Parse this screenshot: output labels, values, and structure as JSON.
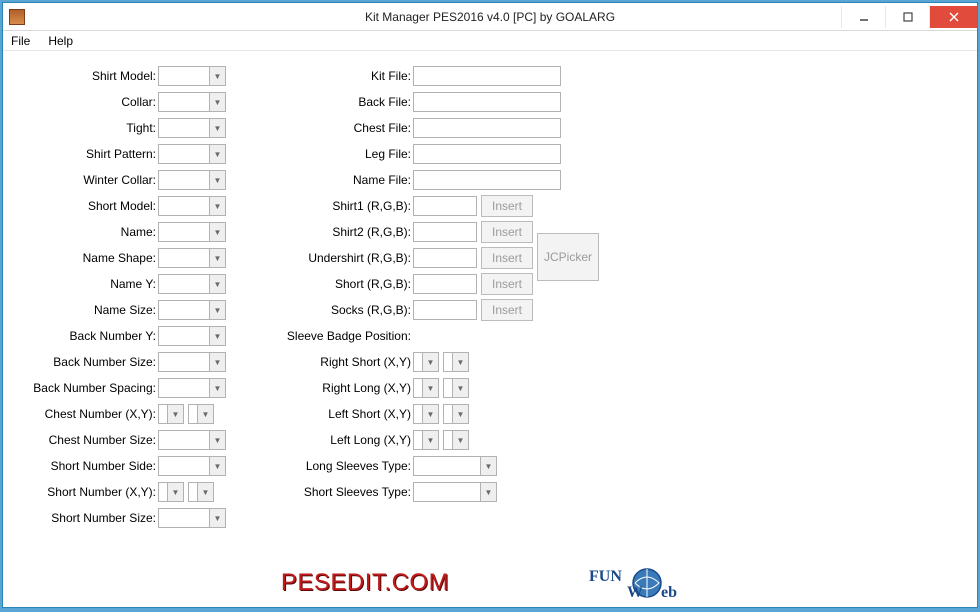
{
  "window": {
    "title": "Kit Manager PES2016 v4.0 [PC] by GOALARG"
  },
  "menu": {
    "file": "File",
    "help": "Help"
  },
  "left_labels": {
    "shirt_model": "Shirt Model:",
    "collar": "Collar:",
    "tight": "Tight:",
    "shirt_pattern": "Shirt Pattern:",
    "winter_collar": "Winter Collar:",
    "short_model": "Short Model:",
    "name": "Name:",
    "name_shape": "Name Shape:",
    "name_y": "Name Y:",
    "name_size": "Name Size:",
    "back_number_y": "Back Number Y:",
    "back_number_size": "Back Number Size:",
    "back_number_spacing": "Back Number Spacing:",
    "chest_number_xy": "Chest Number (X,Y):",
    "chest_number_size": "Chest Number Size:",
    "short_number_side": "Short Number Side:",
    "short_number_xy": "Short Number (X,Y):",
    "short_number_size": "Short Number Size:"
  },
  "right_labels": {
    "kit_file": "Kit File:",
    "back_file": "Back File:",
    "chest_file": "Chest File:",
    "leg_file": "Leg File:",
    "name_file": "Name File:",
    "shirt1_rgb": "Shirt1 (R,G,B):",
    "shirt2_rgb": "Shirt2 (R,G,B):",
    "undershirt_rgb": "Undershirt (R,G,B):",
    "short_rgb": "Short (R,G,B):",
    "socks_rgb": "Socks (R,G,B):",
    "sleeve_badge": "Sleeve Badge Position:",
    "right_short_xy": "Right Short (X,Y)",
    "right_long_xy": "Right Long (X,Y)",
    "left_short_xy": "Left Short (X,Y)",
    "left_long_xy": "Left Long (X,Y)",
    "long_sleeves_type": "Long Sleeves Type:",
    "short_sleeves_type": "Short Sleeves Type:"
  },
  "buttons": {
    "insert": "Insert",
    "jcpicker": "JCPicker"
  },
  "footer": {
    "pesedit": "PESEDIT.COM"
  }
}
